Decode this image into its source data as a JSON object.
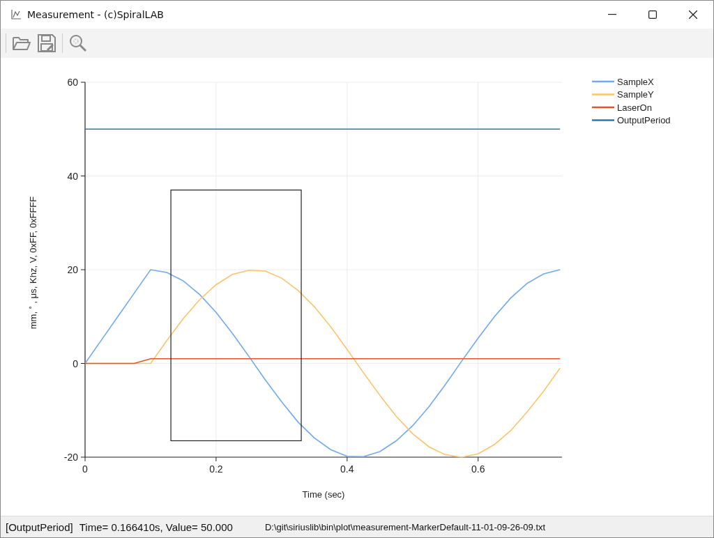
{
  "window": {
    "title": "Measurement - (c)SpiralLAB"
  },
  "toolbar": {
    "buttons": [
      {
        "kind": "open"
      },
      {
        "kind": "save"
      },
      {
        "kind": "zoom"
      }
    ]
  },
  "chart": {
    "chart_data": {
      "type": "line",
      "xlabel": "Time (sec)",
      "ylabel": "mm, ˚ , μs, Khz, V, 0xFF, 0xFFFF",
      "x": [
        0,
        0.025,
        0.05,
        0.075,
        0.1,
        0.125,
        0.15,
        0.175,
        0.2,
        0.225,
        0.25,
        0.275,
        0.3,
        0.325,
        0.35,
        0.375,
        0.4,
        0.425,
        0.45,
        0.475,
        0.5,
        0.525,
        0.55,
        0.575,
        0.6,
        0.625,
        0.65,
        0.675,
        0.7,
        0.725
      ],
      "series": [
        {
          "name": "SampleX",
          "color": "#6fa8f5",
          "values": [
            0,
            5,
            10,
            15,
            20,
            19.4,
            17.6,
            14.7,
            10.9,
            6.4,
            1.5,
            -3.5,
            -8.2,
            -12.5,
            -15.9,
            -18.4,
            -19.8,
            -19.9,
            -18.8,
            -16.5,
            -13.3,
            -9.2,
            -4.5,
            0.5,
            5.4,
            10,
            14,
            17.1,
            19.1,
            20
          ]
        },
        {
          "name": "SampleY",
          "color": "#fdc36a",
          "values": [
            0,
            0,
            0,
            0,
            0,
            4.9,
            9.6,
            13.6,
            16.8,
            19,
            19.9,
            19.7,
            18.2,
            15.6,
            12.1,
            7.8,
            3,
            -2,
            -6.8,
            -11.3,
            -15,
            -17.8,
            -19.5,
            -20,
            -19.3,
            -17.3,
            -14.3,
            -10.3,
            -5.9,
            -1
          ]
        },
        {
          "name": "LaserOn",
          "color": "#e8512a",
          "values": [
            0,
            0,
            0,
            0,
            1,
            1,
            1,
            1,
            1,
            1,
            1,
            1,
            1,
            1,
            1,
            1,
            1,
            1,
            1,
            1,
            1,
            1,
            1,
            1,
            1,
            1,
            1,
            1,
            1,
            1
          ]
        },
        {
          "name": "OutputPeriod",
          "color": "#2a7ba8",
          "values": [
            50,
            50,
            50,
            50,
            50,
            50,
            50,
            50,
            50,
            50,
            50,
            50,
            50,
            50,
            50,
            50,
            50,
            50,
            50,
            50,
            50,
            50,
            50,
            50,
            50,
            50,
            50,
            50,
            50,
            50
          ]
        }
      ],
      "xlim": [
        0,
        0.728
      ],
      "ylim": [
        -20,
        60
      ],
      "xticks": [
        0,
        0.2,
        0.4,
        0.6
      ],
      "yticks": [
        -20,
        0,
        20,
        40,
        60
      ],
      "grid": true,
      "legend": "right"
    },
    "zoom_box": {
      "shown": true
    }
  },
  "status_bar": {
    "series": "[OutputPeriod]",
    "reading": "Time= 0.166410s, Value= 50.000",
    "file_path": "D:\\git\\siriuslib\\bin\\plot\\measurement-MarkerDefault-11-01-09-26-09.txt"
  }
}
